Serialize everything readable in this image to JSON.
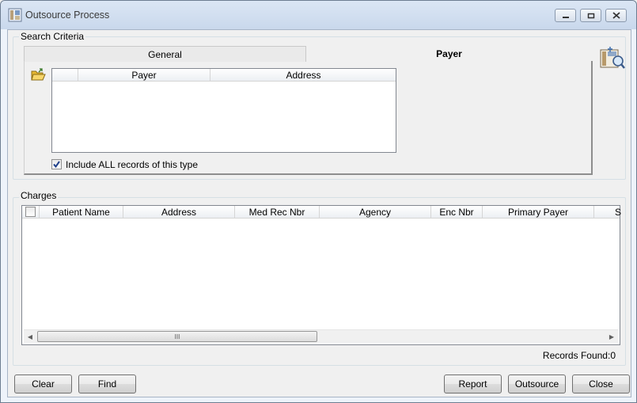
{
  "window": {
    "title": "Outsource Process"
  },
  "search_criteria": {
    "label": "Search Criteria",
    "tabs": [
      {
        "label": "General",
        "selected": false
      },
      {
        "label": "Payer",
        "selected": true
      }
    ],
    "payer_grid": {
      "columns": [
        "Payer",
        "Address"
      ]
    },
    "include_all": {
      "label": "Include ALL records of this type",
      "checked": true
    }
  },
  "charges": {
    "label": "Charges",
    "columns": [
      "Patient Name",
      "Address",
      "Med Rec Nbr",
      "Agency",
      "Enc Nbr",
      "Primary Payer",
      "S"
    ],
    "records_found_label": "Records Found:",
    "records_found_count": "0",
    "scroll_grip": "III"
  },
  "buttons": {
    "clear": "Clear",
    "find": "Find",
    "report": "Report",
    "outsource": "Outsource",
    "close": "Close"
  },
  "icons": {
    "app": "ts-app-icon",
    "open_folder": "open-folder-icon",
    "search_tool": "ts-search-icon"
  },
  "colors": {
    "titlebar": "#c9d8ec",
    "client": "#f0f0f0",
    "checkmark": "#1f3f8a"
  }
}
